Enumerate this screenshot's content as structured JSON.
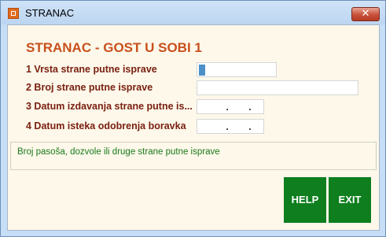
{
  "window": {
    "title": "STRANAC",
    "close_glyph": "✕",
    "app_icon": "app-icon"
  },
  "form": {
    "heading": "STRANAC - GOST U SOBI 1",
    "fields": [
      {
        "label": "1  Vrsta strane putne isprave",
        "value": ""
      },
      {
        "label": "2  Broj strane putne isprave",
        "value": ""
      },
      {
        "label": "3  Datum izdavanja strane putne is...",
        "value": "  .   ."
      },
      {
        "label": "4  Datum isteka odobrenja boravka",
        "value": "  .   ."
      }
    ],
    "hint": "Broj pasoša, dozvole ili druge strane putne isprave"
  },
  "buttons": {
    "help": "HELP",
    "exit": "EXIT"
  },
  "colors": {
    "heading": "#c8501c",
    "label": "#7a2010",
    "hint": "#1a7a1a",
    "button": "#0e7e1e",
    "background": "#fdf8ea"
  }
}
